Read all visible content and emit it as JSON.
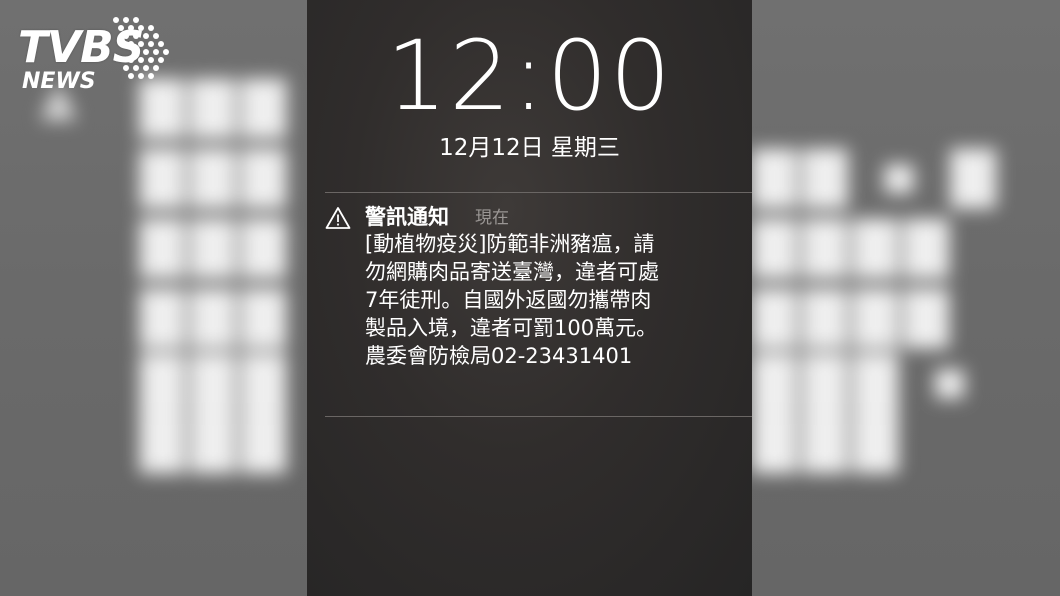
{
  "logo": {
    "brand": "TVBS",
    "sub": "NEWS"
  },
  "lockscreen": {
    "time": "12:00",
    "date": "12月12日 星期三"
  },
  "notification": {
    "icon": "warning-triangle-icon",
    "title": "警訊通知",
    "time": "現在",
    "body": "[動植物疫災]防範非洲豬瘟，請\n勿網購肉品寄送臺灣，違者可處\n7年徒刑。自國外返國勿攜帶肉\n製品入境，違者可罰100萬元。\n農委會防檢局02-23431401"
  }
}
